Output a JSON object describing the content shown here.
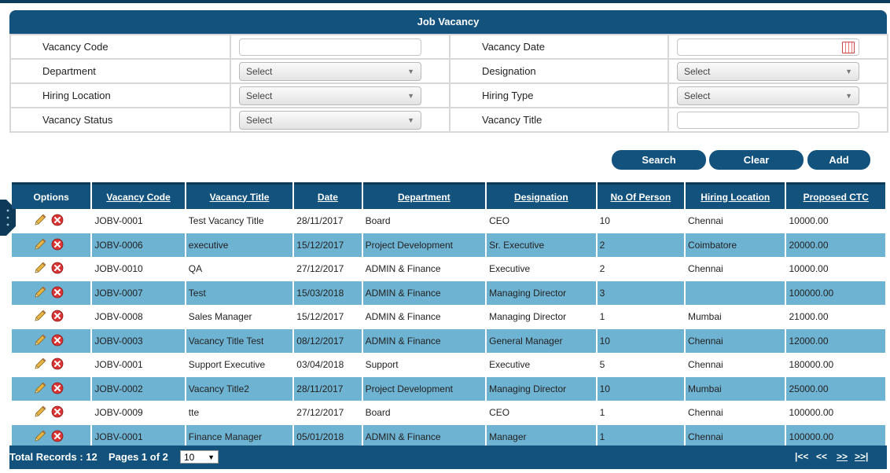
{
  "panel": {
    "title": "Job Vacancy",
    "fields": {
      "vacancy_code_label": "Vacancy Code",
      "vacancy_code_value": "",
      "vacancy_date_label": "Vacancy Date",
      "vacancy_date_value": "",
      "department_label": "Department",
      "department_value": "Select",
      "designation_label": "Designation",
      "designation_value": "Select",
      "hiring_location_label": "Hiring Location",
      "hiring_location_value": "Select",
      "hiring_type_label": "Hiring Type",
      "hiring_type_value": "Select",
      "vacancy_status_label": "Vacancy Status",
      "vacancy_status_value": "Select",
      "vacancy_title_label": "Vacancy Title",
      "vacancy_title_value": ""
    }
  },
  "actions": {
    "search": "Search",
    "clear": "Clear",
    "add": "Add"
  },
  "grid": {
    "headers": {
      "options": "Options",
      "code": "Vacancy Code",
      "title": "Vacancy Title",
      "date": "Date",
      "department": "Department",
      "designation": "Designation",
      "persons": "No Of Person",
      "location": "Hiring Location",
      "ctc": "Proposed CTC"
    },
    "rows": [
      {
        "code": "JOBV-0001",
        "title": "Test Vacancy Title",
        "date": "28/11/2017",
        "department": "Board",
        "designation": "CEO",
        "persons": "10",
        "location": "Chennai",
        "ctc": "10000.00"
      },
      {
        "code": "JOBV-0006",
        "title": "executive",
        "date": "15/12/2017",
        "department": "Project Development",
        "designation": "Sr. Executive",
        "persons": "2",
        "location": "Coimbatore",
        "ctc": "20000.00"
      },
      {
        "code": "JOBV-0010",
        "title": "QA",
        "date": "27/12/2017",
        "department": "ADMIN & Finance",
        "designation": "Executive",
        "persons": "2",
        "location": "Chennai",
        "ctc": "10000.00"
      },
      {
        "code": "JOBV-0007",
        "title": "Test",
        "date": "15/03/2018",
        "department": "ADMIN & Finance",
        "designation": "Managing Director",
        "persons": "3",
        "location": "",
        "ctc": "100000.00"
      },
      {
        "code": "JOBV-0008",
        "title": "Sales Manager",
        "date": "15/12/2017",
        "department": "ADMIN & Finance",
        "designation": "Managing Director",
        "persons": "1",
        "location": "Mumbai",
        "ctc": "21000.00"
      },
      {
        "code": "JOBV-0003",
        "title": "Vacancy Title Test",
        "date": "08/12/2017",
        "department": "ADMIN & Finance",
        "designation": "General Manager",
        "persons": "10",
        "location": "Chennai",
        "ctc": "12000.00"
      },
      {
        "code": "JOBV-0001",
        "title": "Support Executive",
        "date": "03/04/2018",
        "department": "Support",
        "designation": "Executive",
        "persons": "5",
        "location": "Chennai",
        "ctc": "180000.00"
      },
      {
        "code": "JOBV-0002",
        "title": "Vacancy Title2",
        "date": "28/11/2017",
        "department": "Project Development",
        "designation": "Managing Director",
        "persons": "10",
        "location": "Mumbai",
        "ctc": "25000.00"
      },
      {
        "code": "JOBV-0009",
        "title": "tte",
        "date": "27/12/2017",
        "department": "Board",
        "designation": "CEO",
        "persons": "1",
        "location": "Chennai",
        "ctc": "100000.00"
      },
      {
        "code": "JOBV-0001",
        "title": "Finance Manager",
        "date": "05/01/2018",
        "department": "ADMIN & Finance",
        "designation": "Manager",
        "persons": "1",
        "location": "Chennai",
        "ctc": "100000.00"
      }
    ]
  },
  "footer": {
    "total_records": "Total Records : 12",
    "pages": "Pages 1 of 2",
    "page_size": "10",
    "first": "|<<",
    "prev": "<<",
    "next": ">>",
    "last": ">>|"
  },
  "icons": {
    "edit": "pencil-icon",
    "delete": "delete-icon",
    "calendar": "calendar-icon"
  },
  "colors": {
    "header": "#12527c",
    "alt_row": "#6fb3d2",
    "delete": "#d93434"
  }
}
